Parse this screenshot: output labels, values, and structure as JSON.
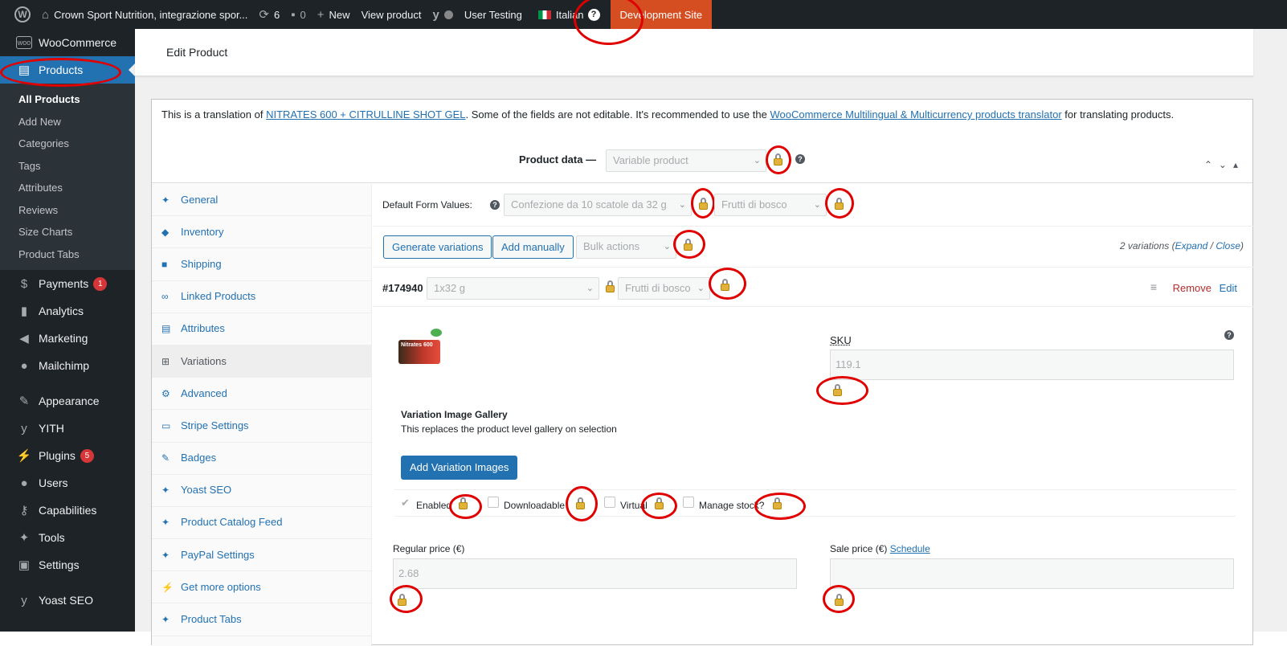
{
  "adminbar": {
    "site": "Crown Sport Nutrition, integrazione spor...",
    "updates": "6",
    "comments": "0",
    "new_label": "New",
    "view_product": "View product",
    "user_testing": "User Testing",
    "language": "Italian",
    "dev_site": "Development Site"
  },
  "sidebar": {
    "woocommerce": "WooCommerce",
    "products": "Products",
    "submenu": [
      "All Products",
      "Add New",
      "Categories",
      "Tags",
      "Attributes",
      "Reviews",
      "Size Charts",
      "Product Tabs"
    ],
    "items": [
      {
        "label": "Payments",
        "badge": "1"
      },
      {
        "label": "Analytics"
      },
      {
        "label": "Marketing"
      },
      {
        "label": "Mailchimp"
      },
      {
        "label": "Appearance"
      },
      {
        "label": "YITH"
      },
      {
        "label": "Plugins",
        "badge": "5"
      },
      {
        "label": "Users"
      },
      {
        "label": "Capabilities"
      },
      {
        "label": "Tools"
      },
      {
        "label": "Settings"
      },
      {
        "label": "Yoast SEO"
      }
    ]
  },
  "page": {
    "title": "Edit Product"
  },
  "notice": {
    "prefix": "This is a translation of",
    "original_link": "NITRATES 600 + CITRULLINE SHOT GEL",
    "middle": ". Some of the fields are not editable. It's recommended to use the",
    "translator_link": "WooCommerce Multilingual & Multicurrency products translator",
    "suffix": "for translating products."
  },
  "product_data": {
    "label": "Product data —",
    "type": "Variable product"
  },
  "tabs": [
    "General",
    "Inventory",
    "Shipping",
    "Linked Products",
    "Attributes",
    "Variations",
    "Advanced",
    "Stripe Settings",
    "Badges",
    "Yoast SEO",
    "Product Catalog Feed",
    "PayPal Settings",
    "Get more options",
    "Product Tabs"
  ],
  "variations": {
    "default_label": "Default Form Values:",
    "default_pack": "Confezione da 10 scatole da 32 g",
    "default_flavor": "Frutti di bosco",
    "generate": "Generate variations",
    "add_manually": "Add manually",
    "bulk": "Bulk actions",
    "count": "2 variations",
    "expand": "Expand",
    "close": "Close",
    "var_id": "#174940",
    "var_size": "1x32 g",
    "var_flavor": "Frutti di bosco",
    "remove": "Remove",
    "edit": "Edit",
    "sku_label": "SKU",
    "sku_value": "119.1",
    "gallery_title": "Variation Image Gallery",
    "gallery_desc": "This replaces the product level gallery on selection",
    "add_images": "Add Variation Images",
    "enabled": "Enabled",
    "downloadable": "Downloadable",
    "virtual": "Virtual",
    "manage_stock": "Manage stock?",
    "regular_label": "Regular price (€)",
    "regular_value": "2.68",
    "sale_label": "Sale price (€)",
    "schedule": "Schedule",
    "product_img_text": "Nitrates 600"
  }
}
